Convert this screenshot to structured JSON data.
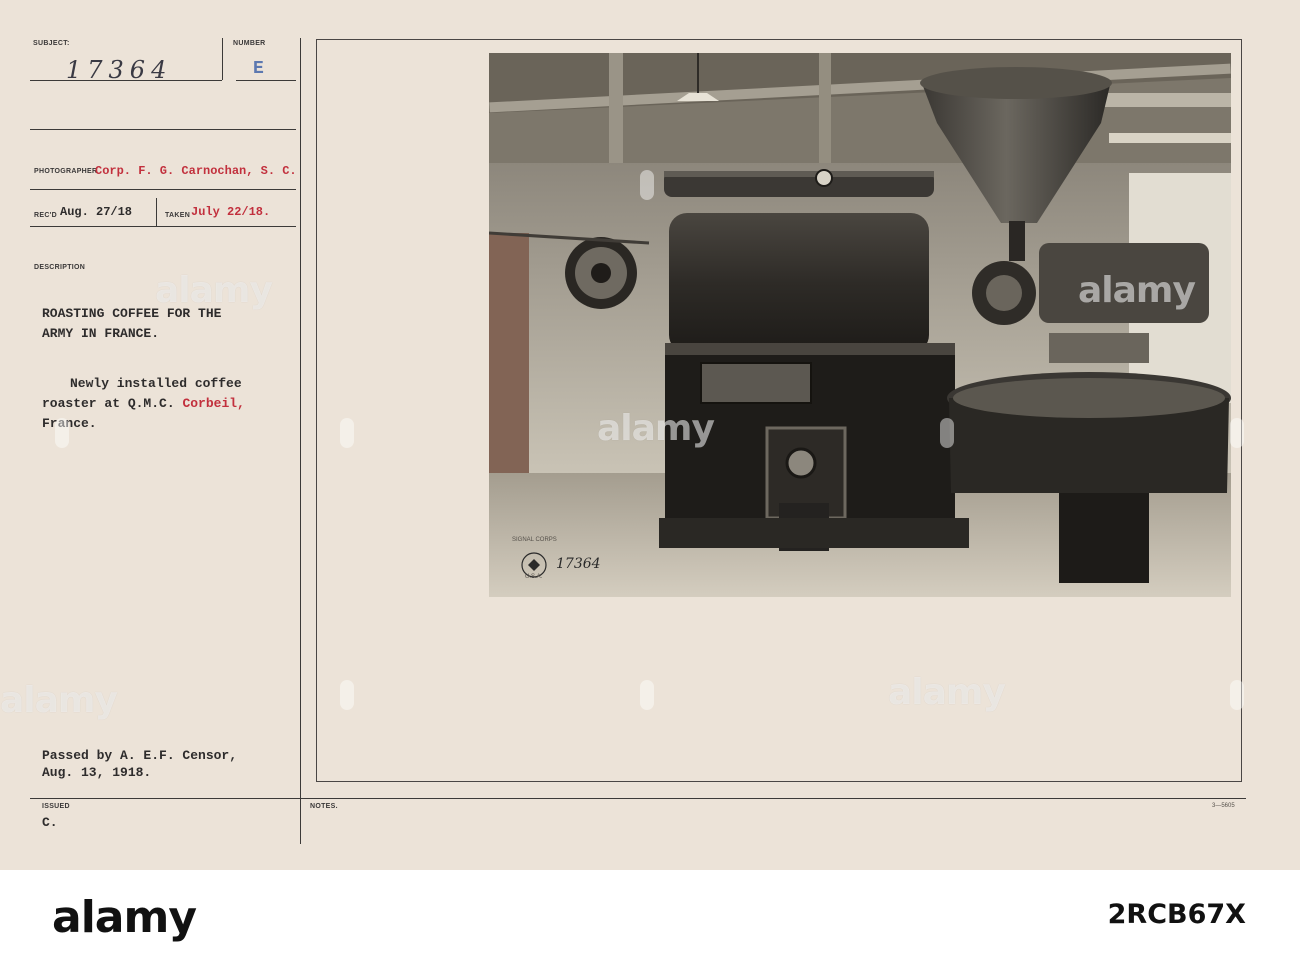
{
  "card": {
    "subject_label": "SUBJECT:",
    "number_label": "NUMBER",
    "subject_value": "17364",
    "number_value": "E",
    "photographer_label": "PHOTOGRAPHER",
    "photographer_value": "Corp. F. G. Carnochan, S. C.",
    "recd_label": "REC'D",
    "recd_value": "Aug. 27/18",
    "taken_label": "TAKEN",
    "taken_value": "July 22/18.",
    "description_label": "DESCRIPTION",
    "title_line1": "ROASTING COFFEE FOR THE",
    "title_line2": "ARMY IN FRANCE.",
    "desc_line1": "Newly installed coffee",
    "desc_line2_prefix": "roaster at Q.M.C. ",
    "desc_line2_red": "Corbeil,",
    "desc_line3": "France.",
    "censor_line1": "Passed by A. E.F. Censor,",
    "censor_line2": "Aug. 13, 1918.",
    "issued_label": "ISSUED",
    "issued_value": "C.",
    "notes_label": "NOTES.",
    "form_code": "3—5605"
  },
  "photo": {
    "number": "17364",
    "seal_top": "SIGNAL CORPS",
    "seal_bottom": "U.S.A."
  },
  "watermark": {
    "text": "alamy"
  },
  "footer": {
    "logo": "alamy",
    "image_id": "2RCB67X"
  }
}
